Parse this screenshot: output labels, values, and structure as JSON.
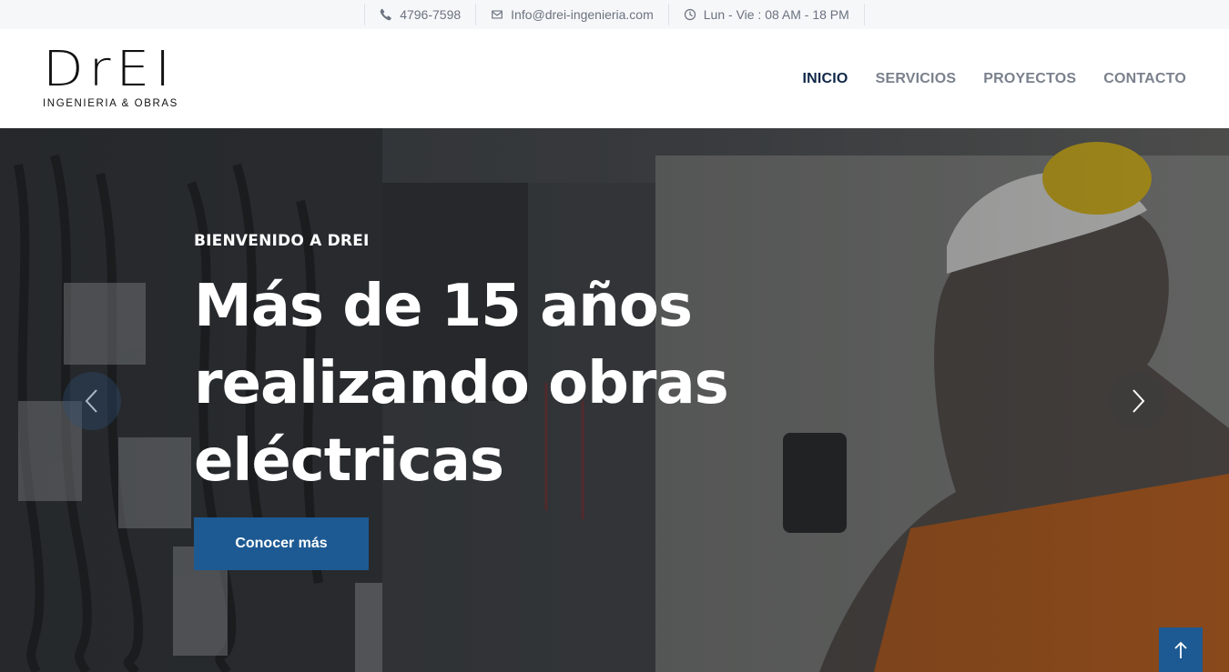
{
  "topbar": {
    "phone": "4796-7598",
    "email": "Info@drei-ingenieria.com",
    "hours": "Lun - Vie : 08 AM - 18 PM"
  },
  "brand": {
    "name": "DrEI",
    "tagline": "INGENIERIA & OBRAS"
  },
  "nav": {
    "items": [
      {
        "label": "INICIO",
        "active": true
      },
      {
        "label": "SERVICIOS",
        "active": false
      },
      {
        "label": "PROYECTOS",
        "active": false
      },
      {
        "label": "CONTACTO",
        "active": false
      }
    ]
  },
  "hero": {
    "kicker": "BIENVENIDO A DREI",
    "headline": "Más de 15 años realizando obras eléctricas",
    "cta_label": "Conocer más"
  },
  "icons": {
    "phone": "phone-icon",
    "email": "envelope-icon",
    "hours": "clock-icon",
    "prev": "chevron-left-icon",
    "next": "chevron-right-icon",
    "top": "arrow-up-icon"
  },
  "colors": {
    "accent": "#1d5a93",
    "nav_active": "#0f2748",
    "nav_inactive": "#7a818c"
  }
}
